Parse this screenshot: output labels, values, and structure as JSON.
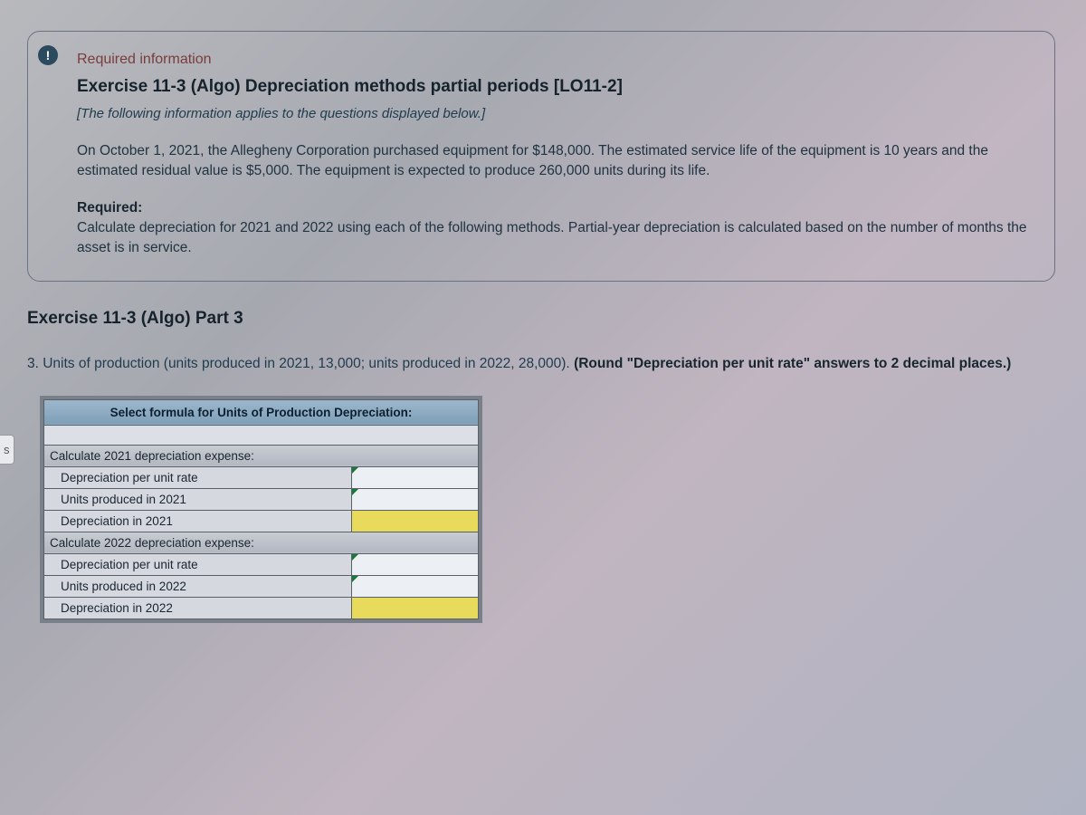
{
  "leftTab": "s",
  "infoIcon": "!",
  "requiredHeading": "Required information",
  "exerciseTitle": "Exercise 11-3 (Algo) Depreciation methods partial periods [LO11-2]",
  "instruction": "[The following information applies to the questions displayed below.]",
  "bodyText": "On October 1, 2021, the Allegheny Corporation purchased equipment for $148,000. The estimated service life of the equipment is 10 years and the estimated residual value is $5,000. The equipment is expected to produce 260,000 units during its life.",
  "requiredLabel": "Required:",
  "requiredBody": "Calculate depreciation for 2021 and 2022 using each of the following methods. Partial-year depreciation is calculated based on the number of months the asset is in service.",
  "partTitle": "Exercise 11-3 (Algo) Part 3",
  "questionPrefix": "3. ",
  "questionText": "Units of production (units produced in 2021, 13,000; units produced in 2022, 28,000). ",
  "roundNote": "(Round \"Depreciation per unit rate\" answers to 2 decimal places.)",
  "table": {
    "formulaHeader": "Select formula for Units of Production Depreciation:",
    "section2021": "Calculate 2021 depreciation expense:",
    "rows2021": {
      "rate": "Depreciation per unit rate",
      "units": "Units produced in 2021",
      "dep": "Depreciation in 2021"
    },
    "section2022": "Calculate 2022 depreciation expense:",
    "rows2022": {
      "rate": "Depreciation per unit rate",
      "units": "Units produced in 2022",
      "dep": "Depreciation in 2022"
    }
  }
}
